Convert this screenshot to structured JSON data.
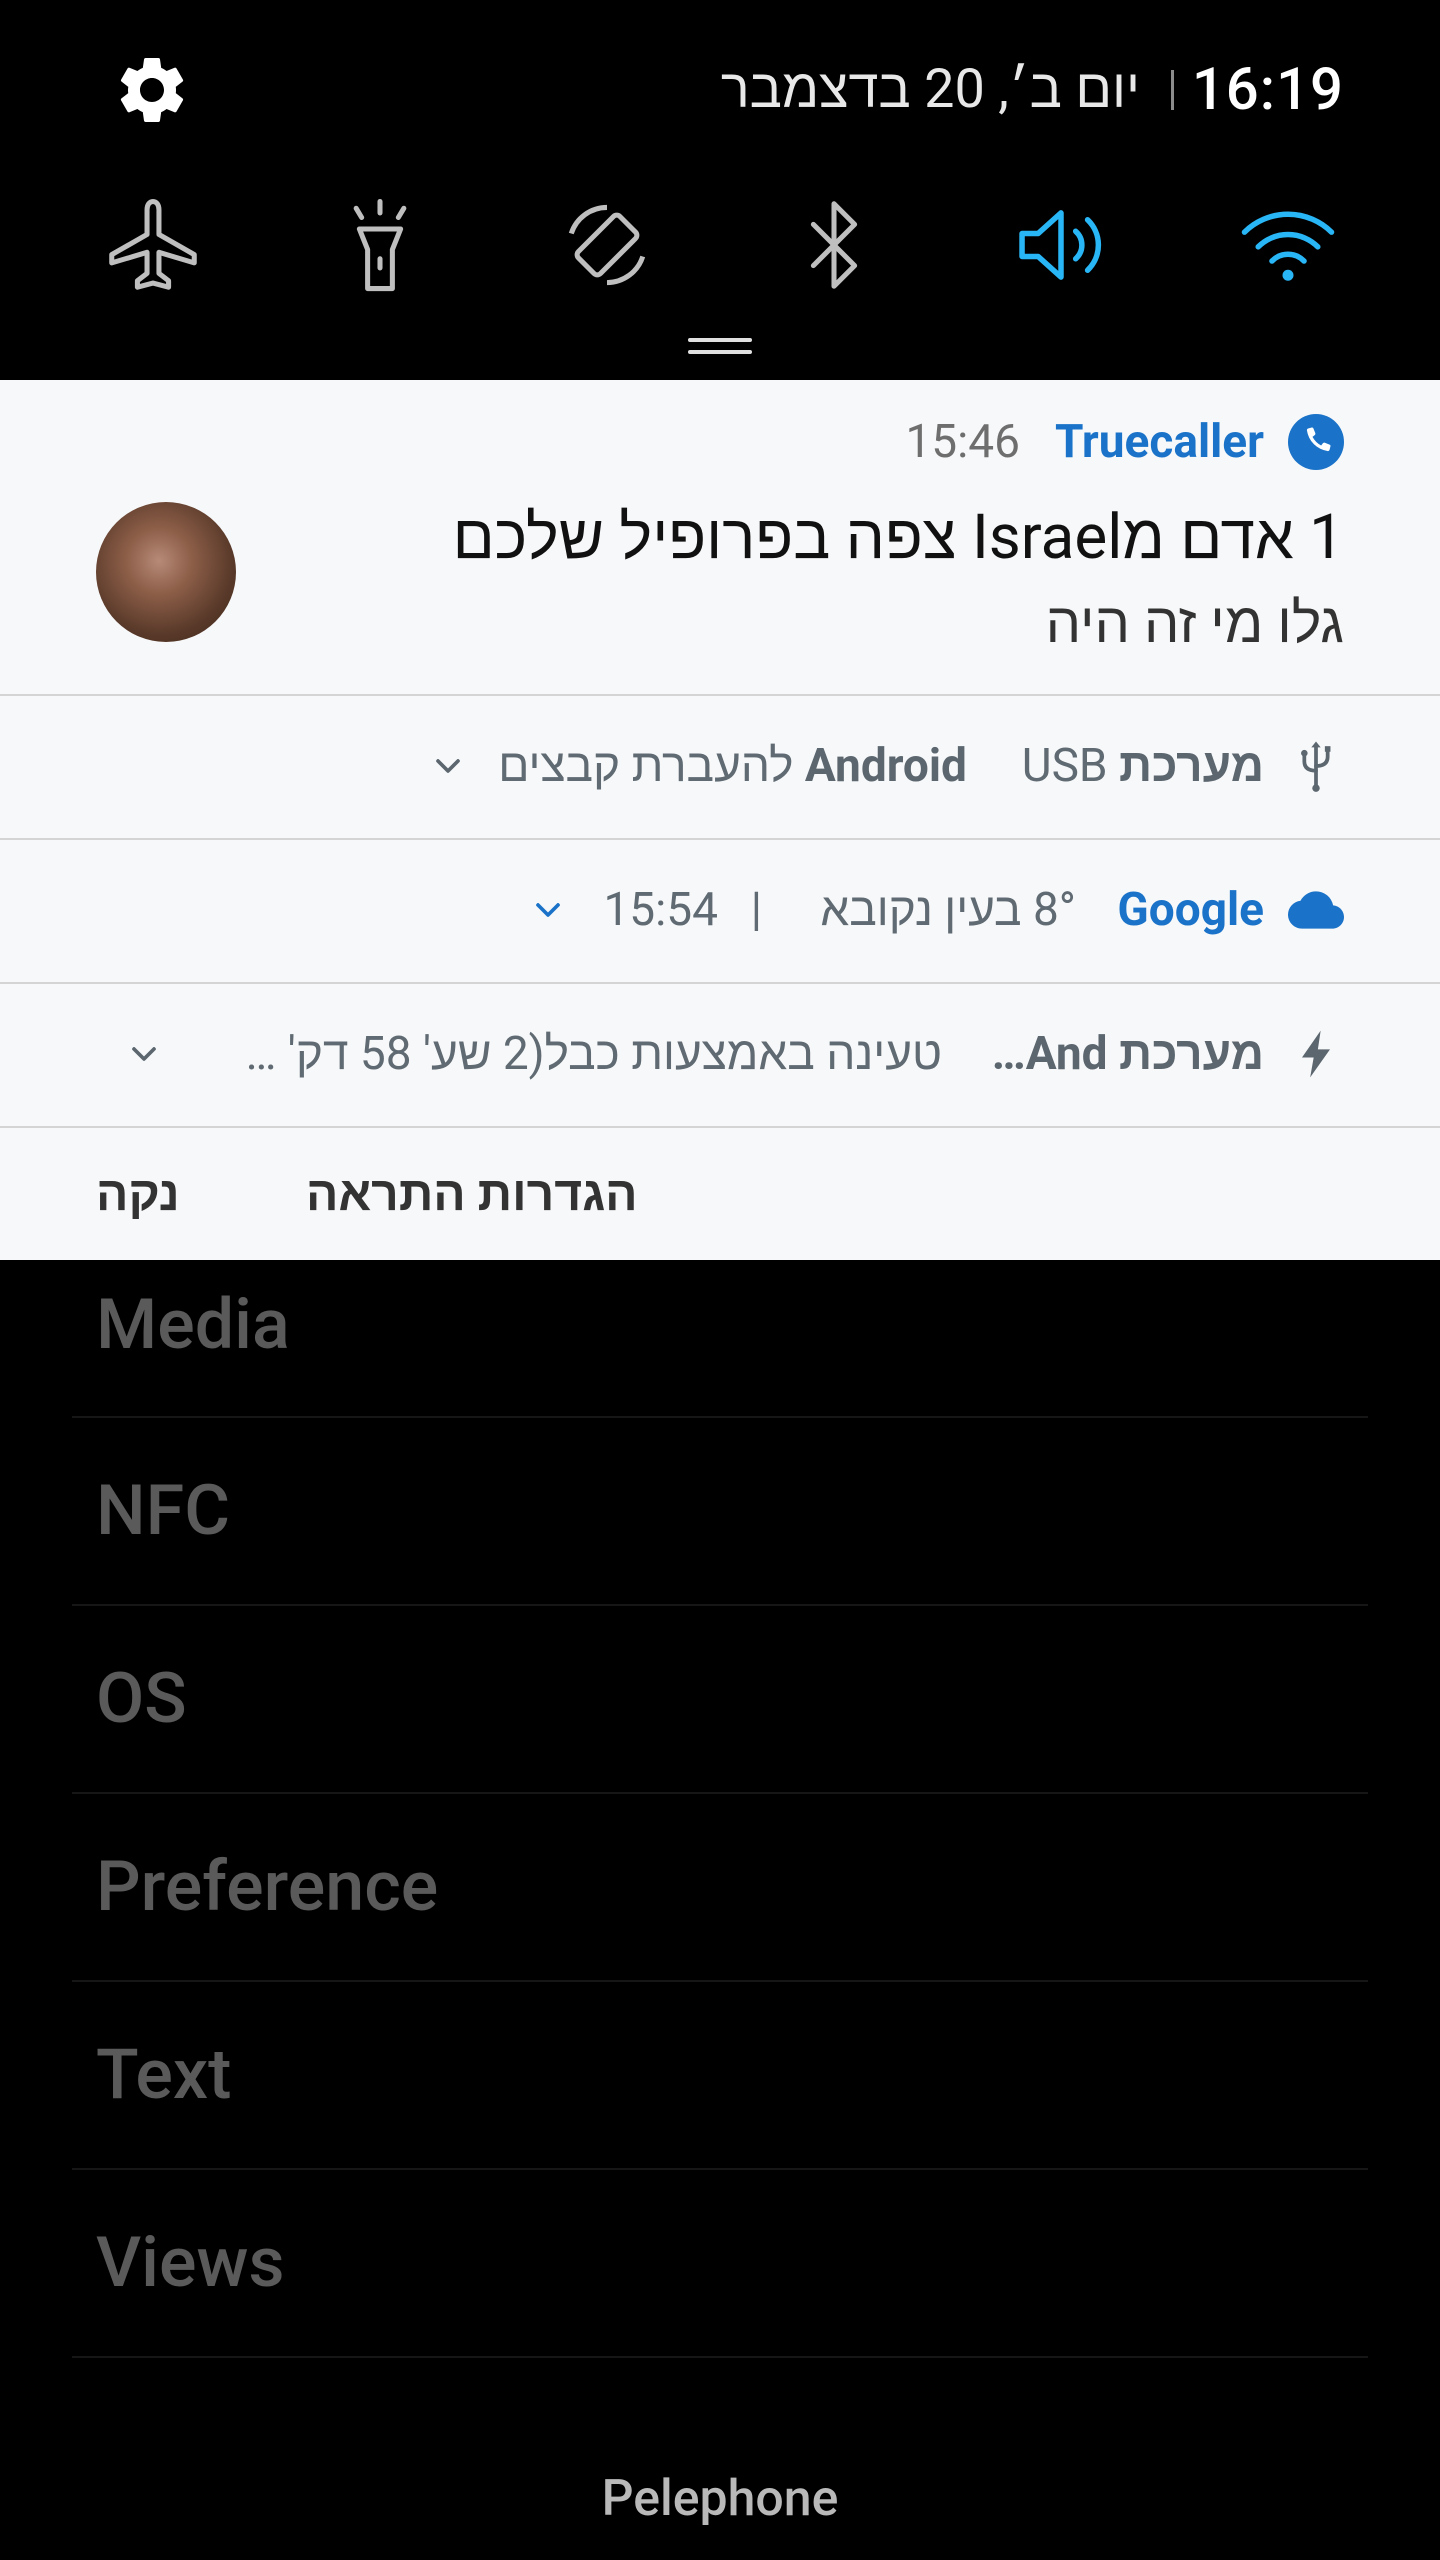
{
  "status_bar": {
    "time": "16:19",
    "date": "יום ב׳, 20 בדצמבר"
  },
  "quick_settings": [
    {
      "name": "airplane",
      "active": false
    },
    {
      "name": "flashlight",
      "active": false
    },
    {
      "name": "auto-rotate",
      "active": false
    },
    {
      "name": "bluetooth",
      "active": false
    },
    {
      "name": "sound",
      "active": true
    },
    {
      "name": "wifi",
      "active": true
    }
  ],
  "colors": {
    "accent": "#1a73c9",
    "qs_active": "#29b6f6",
    "qs_inactive": "#bfbfbf"
  },
  "notifications": {
    "truecaller": {
      "app": "Truecaller",
      "time": "15:46",
      "title": "1 אדם מIsrael צפה בפרופיל שלכם",
      "text": "גלו מי זה היה"
    },
    "usb": {
      "app": "מערכת Android",
      "text": "USB להעברת קבצים"
    },
    "google": {
      "app": "Google",
      "text": "8° בעין נקובא",
      "separator": "|",
      "time": "15:54"
    },
    "charging": {
      "app": "מערכת And…",
      "text": "טעינה באמצעות כבל(2 שע' 58 דק' …"
    }
  },
  "footer": {
    "clear": "נקה",
    "settings": "הגדרות התראה"
  },
  "list": [
    "Media",
    "NFC",
    "OS",
    "Preference",
    "Text",
    "Views"
  ],
  "carrier": "Pelephone"
}
